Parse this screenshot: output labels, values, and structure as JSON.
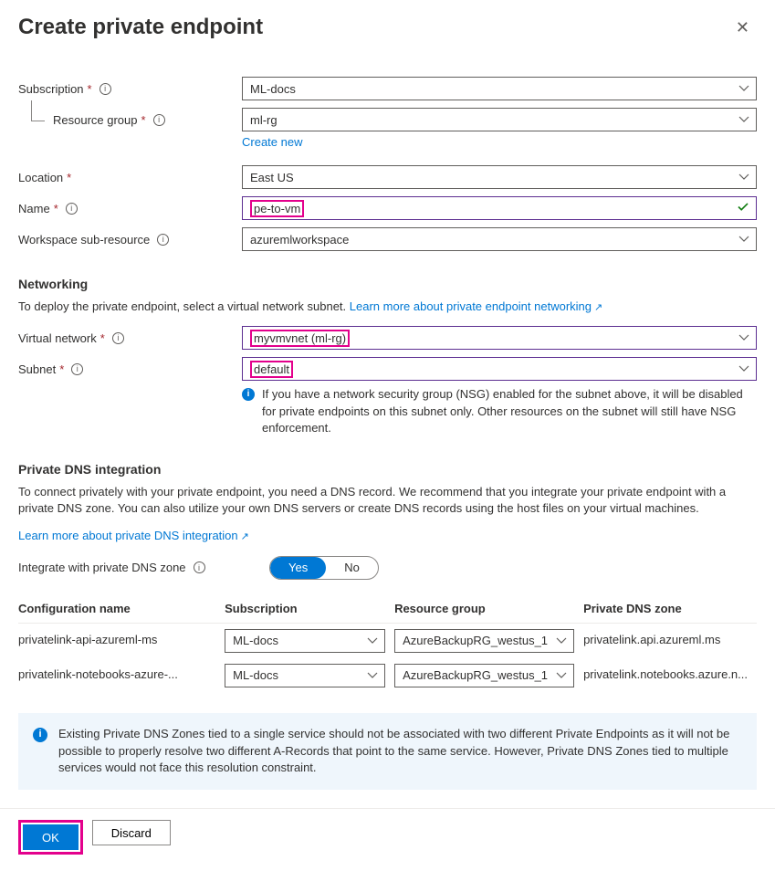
{
  "header": {
    "title": "Create private endpoint"
  },
  "labels": {
    "subscription": "Subscription",
    "resource_group": "Resource group",
    "location": "Location",
    "name": "Name",
    "subresource": "Workspace sub-resource",
    "vnet": "Virtual network",
    "subnet": "Subnet",
    "integrate_dns": "Integrate with private DNS zone"
  },
  "values": {
    "subscription": "ML-docs",
    "resource_group": "ml-rg",
    "create_new": "Create new",
    "location": "East US",
    "name": "pe-to-vm",
    "subresource": "azuremlworkspace",
    "vnet": "myvmvnet (ml-rg)",
    "subnet": "default"
  },
  "networking": {
    "heading": "Networking",
    "desc_prefix": "To deploy the private endpoint, select a virtual network subnet. ",
    "learn_more": "Learn more about private endpoint networking",
    "nsg_note": "If you have a network security group (NSG) enabled for the subnet above, it will be disabled for private endpoints on this subnet only. Other resources on the subnet will still have NSG enforcement."
  },
  "dns": {
    "heading": "Private DNS integration",
    "desc": "To connect privately with your private endpoint, you need a DNS record. We recommend that you integrate your private endpoint with a private DNS zone. You can also utilize your own DNS servers or create DNS records using the host files on your virtual machines.",
    "learn_more": "Learn more about private DNS integration",
    "toggle": {
      "yes": "Yes",
      "no": "No",
      "active": "yes"
    },
    "cols": {
      "config": "Configuration name",
      "sub": "Subscription",
      "rg": "Resource group",
      "zone": "Private DNS zone"
    },
    "rows": [
      {
        "config": "privatelink-api-azureml-ms",
        "sub": "ML-docs",
        "rg": "AzureBackupRG_westus_1",
        "zone": "privatelink.api.azureml.ms"
      },
      {
        "config": "privatelink-notebooks-azure-...",
        "sub": "ML-docs",
        "rg": "AzureBackupRG_westus_1",
        "zone": "privatelink.notebooks.azure.n..."
      }
    ],
    "alert": "Existing Private DNS Zones tied to a single service should not be associated with two different Private Endpoints as it will not be possible to properly resolve two different A-Records that point to the same service. However, Private DNS Zones tied to multiple services would not face this resolution constraint."
  },
  "footer": {
    "ok": "OK",
    "discard": "Discard"
  }
}
